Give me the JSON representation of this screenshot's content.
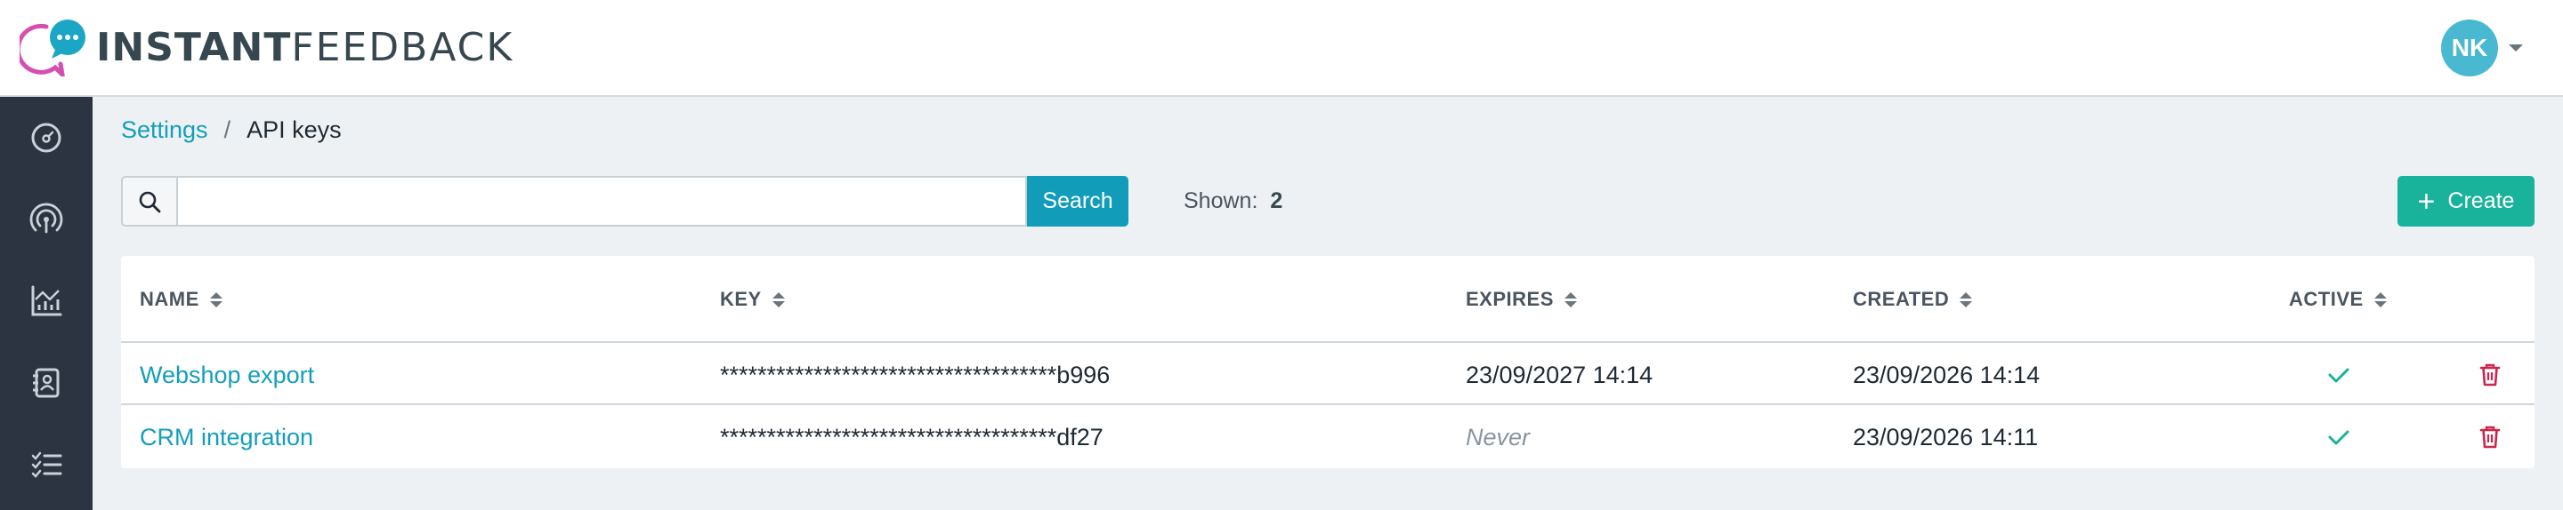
{
  "header": {
    "logo_bold": "INSTANT",
    "logo_light": "FEEDBACK",
    "user_initials": "NK"
  },
  "sidebar": {
    "items": [
      {
        "icon": "dashboard-gauge-icon"
      },
      {
        "icon": "broadcast-icon"
      },
      {
        "icon": "analytics-chart-icon"
      },
      {
        "icon": "contacts-book-icon"
      },
      {
        "icon": "checklist-icon"
      }
    ]
  },
  "breadcrumb": {
    "parent": "Settings",
    "separator": "/",
    "current": "API keys"
  },
  "toolbar": {
    "search_value": "",
    "search_placeholder": "",
    "search_button": "Search",
    "shown_label": "Shown:",
    "shown_count": "2",
    "create_button": "Create"
  },
  "table": {
    "columns": [
      "NAME",
      "KEY",
      "EXPIRES",
      "CREATED",
      "ACTIVE"
    ],
    "rows": [
      {
        "name": "Webshop export",
        "key": "************************************b996",
        "expires": "23/09/2027 14:14",
        "created": "23/09/2026 14:14",
        "active": true
      },
      {
        "name": "CRM integration",
        "key": "************************************df27",
        "expires": "Never",
        "created": "23/09/2026 14:11",
        "active": true
      }
    ]
  },
  "colors": {
    "accent": "#139ebb",
    "create": "#19b29b",
    "delete": "#d0254b",
    "active_check": "#19b29b",
    "sidebar": "#2b3440",
    "avatar": "#48b9d0"
  }
}
